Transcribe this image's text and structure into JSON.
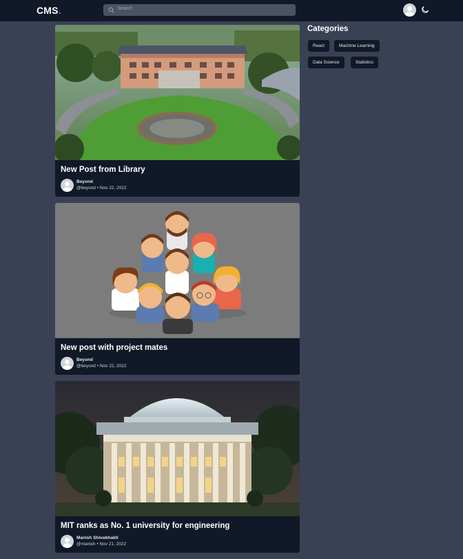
{
  "navbar": {
    "logo_text": "CMS",
    "logo_dot": ".",
    "search_placeholder": "Search",
    "icons": [
      "search-icon",
      "user-avatar-icon",
      "moon-icon"
    ]
  },
  "posts": [
    {
      "title": "New Post from Library",
      "author": "Beyond",
      "handle": "@beyond",
      "date": "Nov 22, 2022"
    },
    {
      "title": "New post with project mates",
      "author": "Beyond",
      "handle": "@beyond",
      "date": "Nov 22, 2022"
    },
    {
      "title": "MIT ranks as No. 1 university for engineering",
      "author": "Manish Shivabhakti",
      "handle": "@manish",
      "date": "Nov 21, 2022"
    }
  ],
  "meta_separator": "•",
  "sidebar": {
    "title": "Categories",
    "categories": [
      "React",
      "Machine Learning",
      "Data Science",
      "Statistics"
    ]
  },
  "colors": {
    "background": "#3b4155",
    "navbar": "#111827",
    "card": "#111827",
    "accent": "#3b82f6"
  }
}
